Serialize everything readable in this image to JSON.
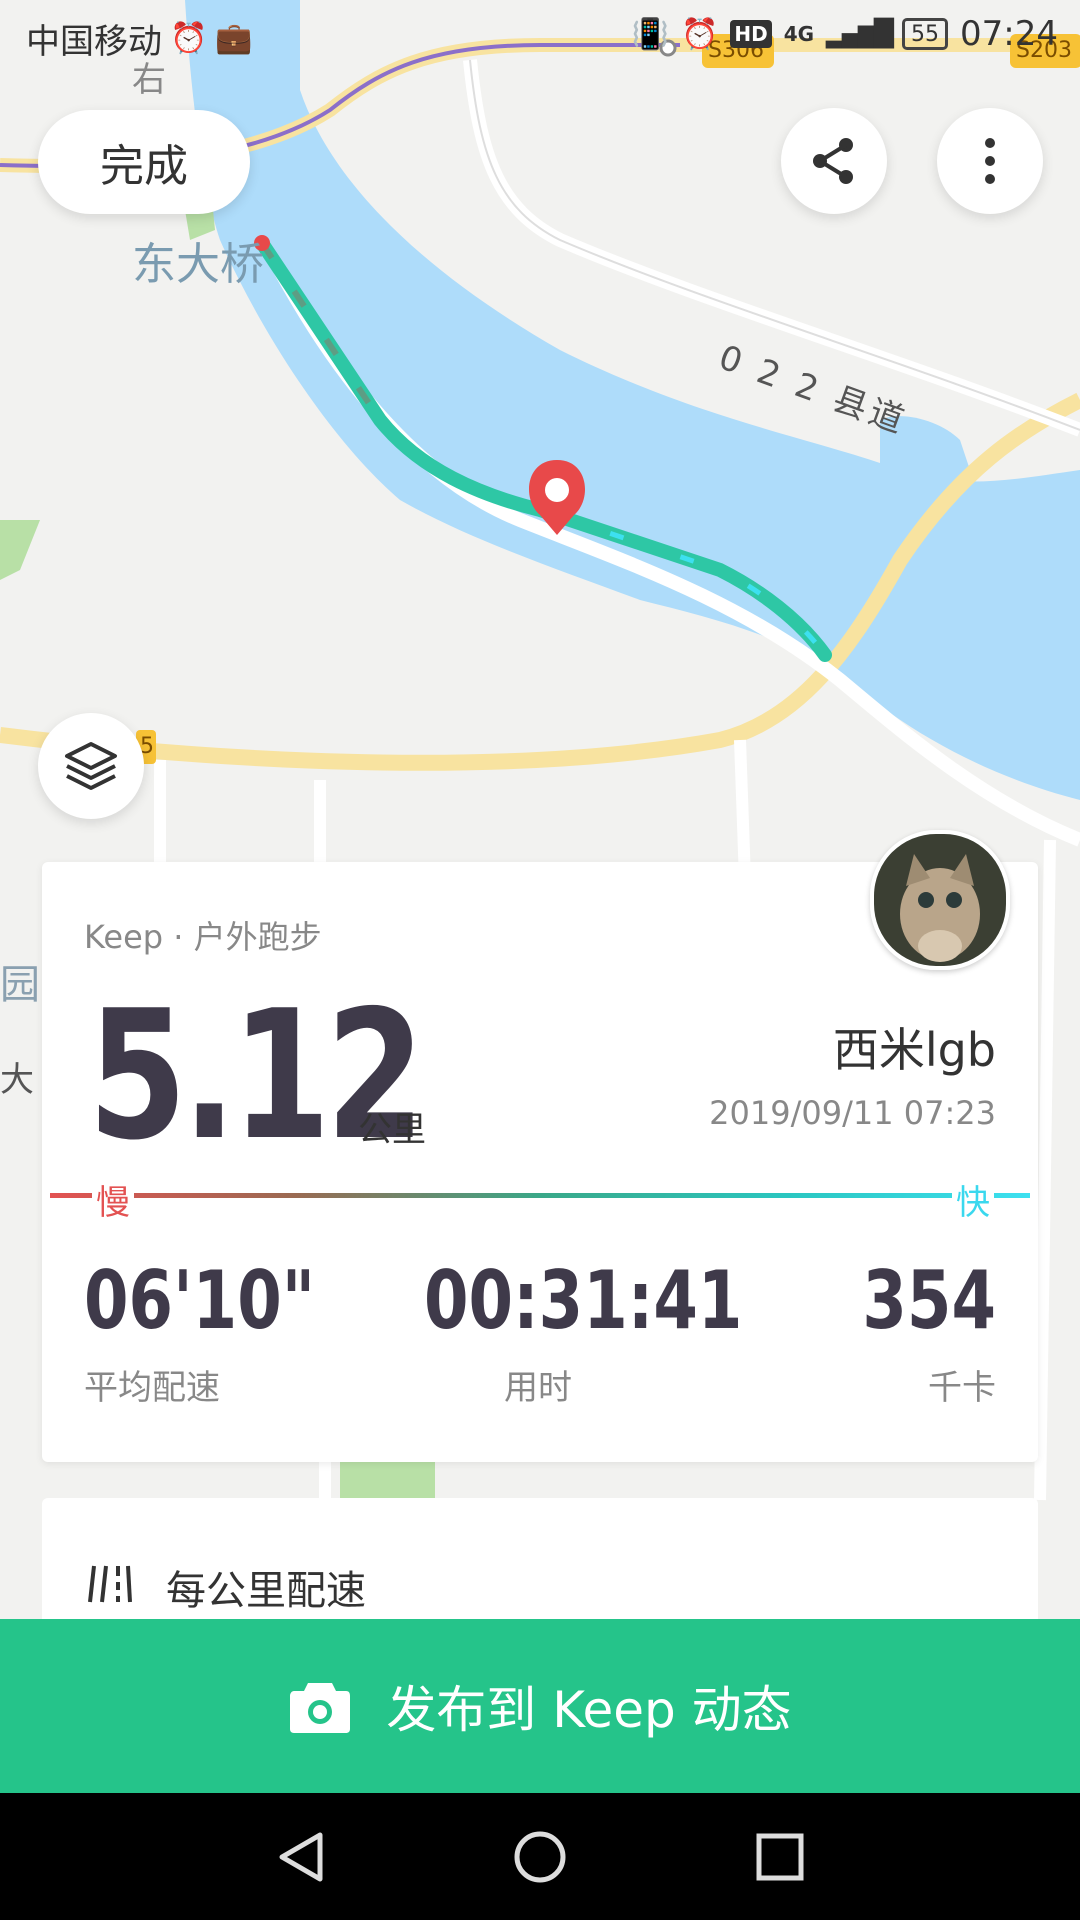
{
  "status_bar": {
    "carrier": "中国移动",
    "hd": "HD",
    "network": "4G",
    "battery": "55",
    "time": "07:24"
  },
  "map": {
    "labels": {
      "bridge": "东大桥",
      "road": "0 2 2 县道",
      "road_s306": "S306",
      "road_s203": "S203",
      "left_top": "右",
      "left_mid": "园",
      "left_low": "大",
      "left_sign": "5"
    }
  },
  "toolbar": {
    "done_label": "完成"
  },
  "summary": {
    "source": "Keep · 户外跑步",
    "distance": "5.12",
    "distance_unit": "公里",
    "username": "西米lgb",
    "datetime": "2019/09/11 07:23",
    "pace_slow": "慢",
    "pace_fast": "快",
    "stats": [
      {
        "value": "06'10\"",
        "label": "平均配速"
      },
      {
        "value": "00:31:41",
        "label": "用时"
      },
      {
        "value": "354",
        "label": "千卡"
      }
    ]
  },
  "splits": {
    "title": "每公里配速"
  },
  "publish": {
    "label": "发布到 Keep 动态"
  },
  "colors": {
    "accent": "#25c48a",
    "water": "#aedcfa",
    "route": "#2ec7a5",
    "marker": "#e8494a"
  }
}
